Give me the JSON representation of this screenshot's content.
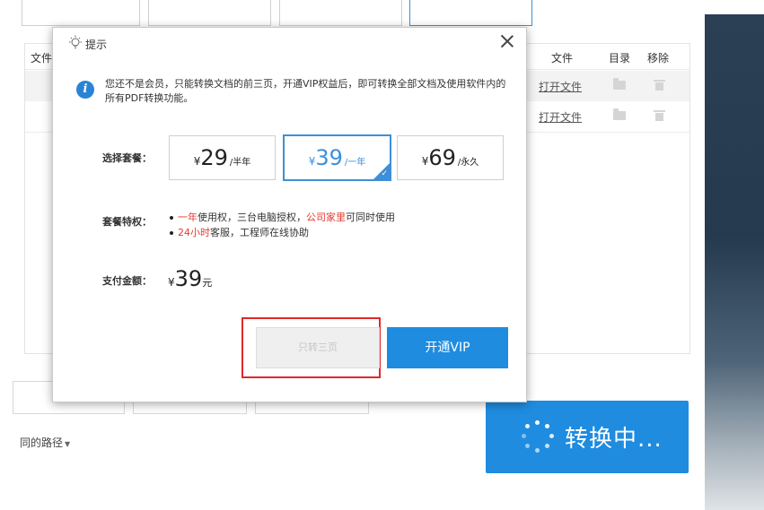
{
  "table": {
    "headers": {
      "file": "文件",
      "file_col": "文件",
      "dir": "目录",
      "remove": "移除"
    },
    "rows": [
      {
        "open": "打开文件"
      },
      {
        "open": "打开文件"
      }
    ]
  },
  "output": {
    "path_label": "同的路径"
  },
  "convert": {
    "label": "转换中..."
  },
  "dialog": {
    "title": "提示",
    "notice": "您还不是会员，只能转换文档的前三页，开通VIP权益后，即可转换全部文档及使用软件内的所有PDF转换功能。",
    "plan_label": "选择套餐：",
    "plans": [
      {
        "currency": "¥",
        "price": "29",
        "unit": "/半年"
      },
      {
        "currency": "¥",
        "price": "39",
        "unit": "/一年"
      },
      {
        "currency": "¥",
        "price": "69",
        "unit": "/永久"
      }
    ],
    "selected_plan": 1,
    "features_label": "套餐特权：",
    "feature1": {
      "a": "一年",
      "b": "使用权，三台电脑授权，",
      "c": "公司家里",
      "d": "可同时使用"
    },
    "feature2": {
      "a": "24小时",
      "b": "客服，工程师在线协助"
    },
    "pay_label": "支付金额：",
    "pay": {
      "currency": "¥",
      "amount": "39",
      "unit": "元"
    },
    "btn_trial": "只转三页",
    "btn_vip": "开通VIP"
  },
  "colors": {
    "accent": "#1f8ce0",
    "highlight_red": "#e23a2d",
    "outline_red": "#e2272a"
  }
}
